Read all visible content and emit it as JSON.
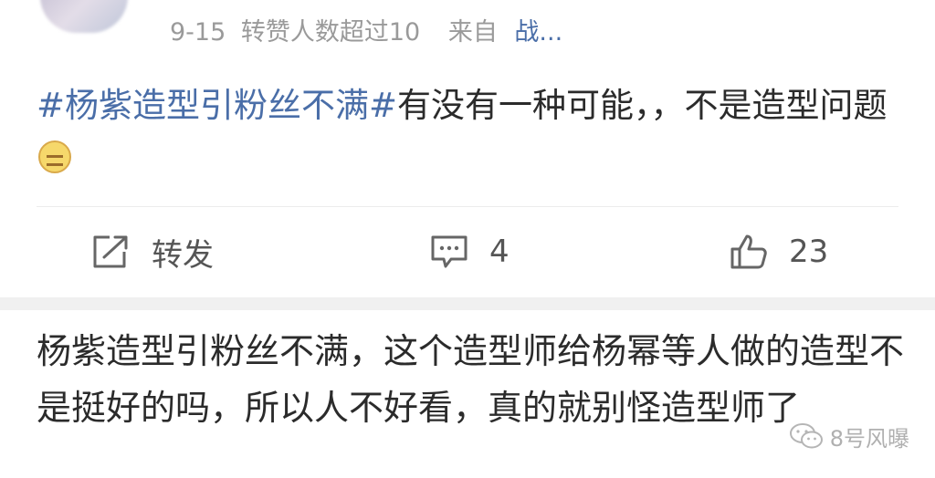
{
  "post": {
    "meta": {
      "date": "9-15",
      "repost_info": "转赞人数超过10",
      "source_prefix": "来自",
      "source_app": "战..."
    },
    "hashtag": "#杨紫造型引粉丝不满#",
    "body_text": "有没有一种可能，，不是造型问题",
    "emoji_icon": "zipper-mouth-face"
  },
  "actions": {
    "repost": {
      "icon": "share-icon",
      "label": "转发"
    },
    "comment": {
      "icon": "comment-icon",
      "count": "4"
    },
    "like": {
      "icon": "thumbs-up-icon",
      "count": "23"
    }
  },
  "comment": {
    "text": "杨紫造型引粉丝不满，这个造型师给杨幂等人做的造型不是挺好的吗，所以人不好看，真的就别怪造型师了"
  },
  "watermark": {
    "icon": "wechat-icon",
    "text": "8号风曝"
  },
  "colors": {
    "link_blue": "#4a6ea8",
    "text": "#2b2b2b",
    "meta_gray": "#9a9a9a",
    "separator": "#f0f0f0"
  }
}
